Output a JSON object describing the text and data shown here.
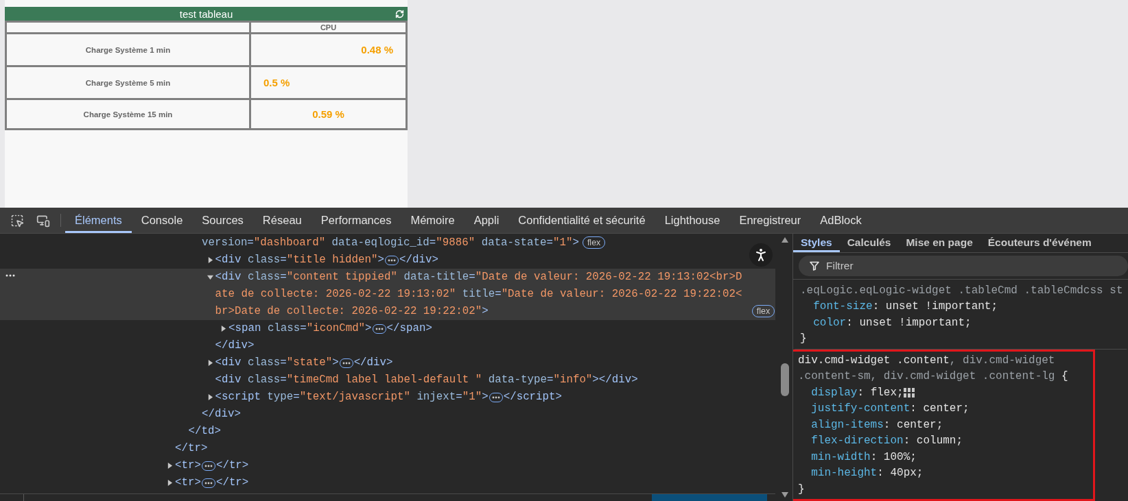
{
  "widget": {
    "title": "test tableau",
    "value_column": "CPU",
    "rows": [
      {
        "label": "Charge Système 1 min",
        "value": "0.48 %"
      },
      {
        "label": "Charge Système 5 min",
        "value": "0.5 %"
      },
      {
        "label": "Charge Système 15 min",
        "value": "0.59 %"
      }
    ]
  },
  "devtools": {
    "tabs": [
      {
        "label": "Éléments",
        "selected": true
      },
      {
        "label": "Console",
        "selected": false
      },
      {
        "label": "Sources",
        "selected": false
      },
      {
        "label": "Réseau",
        "selected": false
      },
      {
        "label": "Performances",
        "selected": false
      },
      {
        "label": "Mémoire",
        "selected": false
      },
      {
        "label": "Appli",
        "selected": false
      },
      {
        "label": "Confidentialité et sécurité",
        "selected": false
      },
      {
        "label": "Lighthouse",
        "selected": false
      },
      {
        "label": "Enregistreur",
        "selected": false
      },
      {
        "label": "AdBlock",
        "selected": false
      }
    ],
    "dom_tree": [
      {
        "kind": "tail",
        "close": "</tr>",
        "children": [
          {
            "kind": "tail",
            "close": "</td>",
            "children": [
              {
                "kind": "continued",
                "selected": false,
                "open": [
                  {
                    "kind": "attr",
                    "text": "version"
                  },
                  {
                    "kind": "punct",
                    "text": "="
                  },
                  {
                    "kind": "value",
                    "text": "\"dashboard\""
                  },
                  {
                    "kind": "attr",
                    "text": " data-eqlogic_id"
                  },
                  {
                    "kind": "punct",
                    "text": "="
                  },
                  {
                    "kind": "value",
                    "text": "\"9886\""
                  },
                  {
                    "kind": "attr",
                    "text": " data-state"
                  },
                  {
                    "kind": "punct",
                    "text": "="
                  },
                  {
                    "kind": "value",
                    "text": "\"1\""
                  },
                  {
                    "kind": "punct",
                    "text": ">"
                  }
                ],
                "badge": "flex",
                "close": "</div>",
                "children": [
                  {
                    "kind": "branch",
                    "expanded": false,
                    "selected": false,
                    "open": [
                      {
                        "kind": "punct",
                        "text": "<div"
                      },
                      {
                        "kind": "attr",
                        "text": " class"
                      },
                      {
                        "kind": "punct",
                        "text": "="
                      },
                      {
                        "kind": "value",
                        "text": "\"title hidden\""
                      },
                      {
                        "kind": "punct",
                        "text": ">"
                      }
                    ],
                    "close": "</div>"
                  },
                  {
                    "kind": "branch",
                    "expanded": true,
                    "selected": true,
                    "open": [
                      {
                        "kind": "punct",
                        "text": "<div"
                      },
                      {
                        "kind": "attr",
                        "text": " class"
                      },
                      {
                        "kind": "punct",
                        "text": "="
                      },
                      {
                        "kind": "value",
                        "text": "\"content tippied\""
                      },
                      {
                        "kind": "attr",
                        "text": " data-title"
                      },
                      {
                        "kind": "punct",
                        "text": "="
                      },
                      {
                        "kind": "value",
                        "text": "\"Date de valeur: 2026-02-22 19:13:02<br>Date de collecte: 2026-02-22 19:13:02\""
                      },
                      {
                        "kind": "attr",
                        "text": " title"
                      },
                      {
                        "kind": "punct",
                        "text": "="
                      },
                      {
                        "kind": "value",
                        "text": "\"Date de valeur: 2026-02-22 19:22:02<br>Date de collecte: 2026-02-22 19:22:02\""
                      },
                      {
                        "kind": "punct",
                        "text": ">"
                      }
                    ],
                    "badge": "flex",
                    "close": "</div>",
                    "children": [
                      {
                        "kind": "branch",
                        "expanded": false,
                        "selected": false,
                        "open": [
                          {
                            "kind": "punct",
                            "text": "<span"
                          },
                          {
                            "kind": "attr",
                            "text": " class"
                          },
                          {
                            "kind": "punct",
                            "text": "="
                          },
                          {
                            "kind": "value",
                            "text": "\"iconCmd\""
                          },
                          {
                            "kind": "punct",
                            "text": ">"
                          }
                        ],
                        "close": "</span>"
                      }
                    ]
                  },
                  {
                    "kind": "branch",
                    "expanded": false,
                    "selected": false,
                    "open": [
                      {
                        "kind": "punct",
                        "text": "<div"
                      },
                      {
                        "kind": "attr",
                        "text": " class"
                      },
                      {
                        "kind": "punct",
                        "text": "="
                      },
                      {
                        "kind": "value",
                        "text": "\"state\""
                      },
                      {
                        "kind": "punct",
                        "text": ">"
                      }
                    ],
                    "close": "</div>"
                  },
                  {
                    "kind": "leaf",
                    "selected": false,
                    "open": [
                      {
                        "kind": "punct",
                        "text": "<div"
                      },
                      {
                        "kind": "attr",
                        "text": " class"
                      },
                      {
                        "kind": "punct",
                        "text": "="
                      },
                      {
                        "kind": "value",
                        "text": "\"timeCmd label label-default \""
                      },
                      {
                        "kind": "attr",
                        "text": " data-type"
                      },
                      {
                        "kind": "punct",
                        "text": "="
                      },
                      {
                        "kind": "value",
                        "text": "\"info\""
                      },
                      {
                        "kind": "punct",
                        "text": ">"
                      }
                    ],
                    "close": "</div>"
                  },
                  {
                    "kind": "branch",
                    "expanded": false,
                    "selected": false,
                    "open": [
                      {
                        "kind": "punct",
                        "text": "<script"
                      },
                      {
                        "kind": "attr",
                        "text": " type"
                      },
                      {
                        "kind": "punct",
                        "text": "="
                      },
                      {
                        "kind": "value",
                        "text": "\"text/javascript\""
                      },
                      {
                        "kind": "attr",
                        "text": " injext"
                      },
                      {
                        "kind": "punct",
                        "text": "="
                      },
                      {
                        "kind": "value",
                        "text": "\"1\""
                      },
                      {
                        "kind": "punct",
                        "text": ">"
                      }
                    ],
                    "close": "</script>"
                  }
                ]
              }
            ]
          }
        ]
      },
      {
        "kind": "branch",
        "expanded": false,
        "selected": false,
        "open": [
          {
            "kind": "punct",
            "text": "<tr>"
          }
        ],
        "close": "</tr>"
      },
      {
        "kind": "branch",
        "expanded": false,
        "selected": false,
        "open": [
          {
            "kind": "punct",
            "text": "<tr>"
          }
        ],
        "close": "</tr>"
      }
    ],
    "styles_pane": {
      "tabs": [
        {
          "label": "Styles",
          "selected": true
        },
        {
          "label": "Calculés",
          "selected": false
        },
        {
          "label": "Mise en page",
          "selected": false
        },
        {
          "label": "Écouteurs d'événem",
          "selected": false
        }
      ],
      "filter": {
        "placeholder": "Filtrer"
      },
      "rules": [
        {
          "highlighted": false,
          "selector": [
            {
              "text": ".eqLogic.eqLogic-widget .tableCmd .tableCmdcss st",
              "matched": false
            }
          ],
          "declarations": [
            {
              "property": "font-size",
              "separator": ":",
              "value": " unset !important;",
              "grid_icon": false
            },
            {
              "property": "color",
              "separator": ":",
              "value": " unset !important;",
              "grid_icon": false
            }
          ],
          "close_brace": "}"
        },
        {
          "highlighted": true,
          "selector": [
            {
              "text": "div.cmd-widget .content",
              "matched": true
            },
            {
              "text": ", div.cmd-widget .content-sm, div.cmd-widget .content-lg",
              "matched": false
            }
          ],
          "open_brace": " {",
          "declarations": [
            {
              "property": "display",
              "separator": ":",
              "value": " flex;",
              "grid_icon": true
            },
            {
              "property": "justify-content",
              "separator": ":",
              "value": " center;",
              "grid_icon": false
            },
            {
              "property": "align-items",
              "separator": ":",
              "value": " center;",
              "grid_icon": false
            },
            {
              "property": "flex-direction",
              "separator": ":",
              "value": " column;",
              "grid_icon": false
            },
            {
              "property": "min-width",
              "separator": ":",
              "value": " 100%;",
              "grid_icon": false
            },
            {
              "property": "min-height",
              "separator": ":",
              "value": " 40px;",
              "grid_icon": false
            }
          ],
          "close_brace": "}"
        }
      ]
    }
  }
}
